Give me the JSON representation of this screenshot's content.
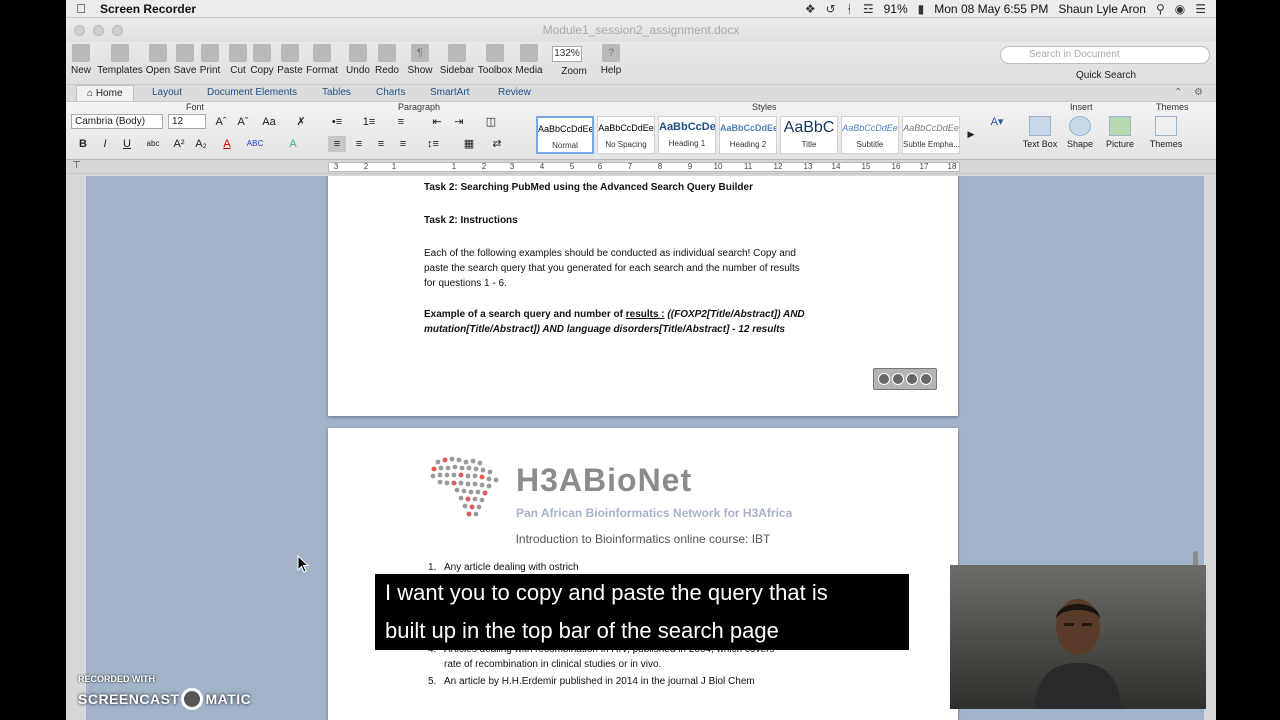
{
  "menubar": {
    "app_name": "Screen Recorder",
    "battery": "91%",
    "datetime": "Mon 08 May  6:55 PM",
    "user": "Shaun Lyle Aron"
  },
  "window": {
    "doc_title": "Module1_session2_assignment.docx"
  },
  "toolbar": {
    "new": "New",
    "templates": "Templates",
    "open": "Open",
    "save": "Save",
    "print": "Print",
    "cut": "Cut",
    "copy": "Copy",
    "paste": "Paste",
    "format": "Format",
    "undo": "Undo",
    "redo": "Redo",
    "show": "Show",
    "sidebar": "Sidebar",
    "toolbox": "Toolbox",
    "media": "Media",
    "zoom_value": "132%",
    "zoom": "Zoom",
    "help": "Help",
    "search_placeholder": "Search in Document",
    "quick_search": "Quick Search"
  },
  "ribbon_tabs": [
    "Home",
    "Layout",
    "Document Elements",
    "Tables",
    "Charts",
    "SmartArt",
    "Review"
  ],
  "ribbon": {
    "font_group": "Font",
    "paragraph_group": "Paragraph",
    "styles_group": "Styles",
    "insert_group": "Insert",
    "themes_group": "Themes",
    "font_name": "Cambria (Body)",
    "font_size": "12",
    "style_sample": "AaBbCcDdEe",
    "styles": [
      {
        "sample": "AaBbCcDdEe",
        "name": "Normal"
      },
      {
        "sample": "AaBbCcDdEe",
        "name": "No Spacing"
      },
      {
        "sample": "AaBbCcDe",
        "name": "Heading 1"
      },
      {
        "sample": "AaBbCcDdEe",
        "name": "Heading 2"
      },
      {
        "sample": "AaBbC",
        "name": "Title"
      },
      {
        "sample": "AaBbCcDdEe",
        "name": "Subtitle"
      },
      {
        "sample": "AaBbCcDdEe",
        "name": "Subtle Empha..."
      }
    ],
    "insert_buttons": [
      "Text Box",
      "Shape",
      "Picture",
      "Themes"
    ]
  },
  "document": {
    "task2_heading": "Task 2: Searching PubMed using the Advanced Search Query Builder",
    "task2_instructions": "Task 2: Instructions",
    "instructions_line1": "Each of the following examples should be conducted as individual search! Copy and",
    "instructions_line2": "paste the search query that you generated for each search and the number of results",
    "instructions_line3": "for questions 1 - 6.",
    "example_prefix": "Example of a search query and number of ",
    "example_results_word": "results :",
    "example_query_1": " ((FOXP2[Title/Abstract]) AND",
    "example_query_2": "mutation[Title/Abstract]) AND language disorders[Title/Abstract] - 12 results",
    "logo_title": "H3ABioNet",
    "logo_subtitle": "Pan African Bioinformatics Network for H3Africa",
    "course_title": "Introduction to Bioinformatics online course: IBT",
    "list": [
      {
        "num": "1.",
        "text": "Any article dealing with ostrich"
      },
      {
        "num": "4.",
        "text": "Articles dealing with recombination in HIV, published in 2004, which covers"
      },
      {
        "num": "",
        "text": "rate of recombination in clinical studies or in vivo."
      },
      {
        "num": "5.",
        "text": "An article by H.H.Erdemir published in 2014 in the journal J Biol Chem"
      }
    ]
  },
  "caption": {
    "line1": "I want you to copy and paste the query that is",
    "line2": "built up in the top bar of the search page"
  },
  "watermark": {
    "recorded_with": "RECORDED WITH",
    "brand_left": "SCREENCAST",
    "brand_right": "MATIC"
  }
}
